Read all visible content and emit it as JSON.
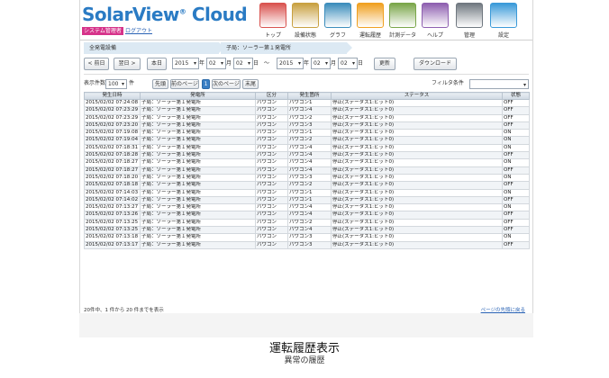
{
  "app": {
    "logo": "SolarView",
    "logo_suffix": "Cloud",
    "system_badge": "システム管理者",
    "logout": "ログアウト"
  },
  "nav": [
    {
      "label": "トップ",
      "icon": "house-icon",
      "color": "#d9534f"
    },
    {
      "label": "設備状態",
      "icon": "building-icon",
      "color": "#c8a040"
    },
    {
      "label": "グラフ",
      "icon": "bar-chart-icon",
      "color": "#3c8dbc"
    },
    {
      "label": "運転履歴",
      "icon": "log-icon",
      "color": "#f0a020"
    },
    {
      "label": "計測データ",
      "icon": "data-sheet-icon",
      "color": "#7aa64a"
    },
    {
      "label": "ヘルプ",
      "icon": "help-book-icon",
      "color": "#8e5fb0"
    },
    {
      "label": "管理",
      "icon": "gears-icon",
      "color": "#707880"
    },
    {
      "label": "設定",
      "icon": "monitor-user-icon",
      "color": "#3a9ad9"
    }
  ],
  "breadcrumb": [
    "全発電設備",
    "子局：ソーラー第１発電所"
  ],
  "datebar": {
    "prev_day": "< 前日",
    "next_day": "翌日 >",
    "today": "本日",
    "from_year": "2015",
    "year_label": "年",
    "from_month": "02",
    "month_label": "月",
    "from_day": "02",
    "day_label": "日",
    "tilde": "～",
    "to_year": "2015",
    "to_month": "02",
    "to_day": "02",
    "refresh": "更新",
    "download": "ダウンロード"
  },
  "pager": {
    "per_page_label": "表示件数",
    "per_page": "100",
    "per_page_unit": "件",
    "first": "先頭",
    "prev": "前のページ",
    "current": "1",
    "next": "次のページ",
    "last": "末尾",
    "filter_label": "フィルタ条件",
    "filter_value": ""
  },
  "table": {
    "headers": [
      "発生日時",
      "発電所",
      "区分",
      "発生箇所",
      "ステータス",
      "状態"
    ],
    "rows": [
      [
        "2015/02/02 07:24:08",
        "子局：ソーラー第１発電所",
        "パワコン",
        "パワコン1",
        "停止(ステータス1:ビット0)",
        "OFF"
      ],
      [
        "2015/02/02 07:23:29",
        "子局：ソーラー第１発電所",
        "パワコン",
        "パワコン4",
        "停止(ステータス1:ビット0)",
        "OFF"
      ],
      [
        "2015/02/02 07:23:29",
        "子局：ソーラー第１発電所",
        "パワコン",
        "パワコン2",
        "停止(ステータス1:ビット0)",
        "OFF"
      ],
      [
        "2015/02/02 07:23:20",
        "子局：ソーラー第１発電所",
        "パワコン",
        "パワコン3",
        "停止(ステータス1:ビット0)",
        "OFF"
      ],
      [
        "2015/02/02 07:19:08",
        "子局：ソーラー第１発電所",
        "パワコン",
        "パワコン1",
        "停止(ステータス1:ビット0)",
        "ON"
      ],
      [
        "2015/02/02 07:19:04",
        "子局：ソーラー第１発電所",
        "パワコン",
        "パワコン2",
        "停止(ステータス1:ビット0)",
        "ON"
      ],
      [
        "2015/02/02 07:18:31",
        "子局：ソーラー第１発電所",
        "パワコン",
        "パワコン4",
        "停止(ステータス1:ビット0)",
        "ON"
      ],
      [
        "2015/02/02 07:18:28",
        "子局：ソーラー第１発電所",
        "パワコン",
        "パワコン4",
        "停止(ステータス1:ビット0)",
        "OFF"
      ],
      [
        "2015/02/02 07:18:27",
        "子局：ソーラー第１発電所",
        "パワコン",
        "パワコン4",
        "停止(ステータス1:ビット0)",
        "ON"
      ],
      [
        "2015/02/02 07:18:27",
        "子局：ソーラー第１発電所",
        "パワコン",
        "パワコン4",
        "停止(ステータス1:ビット0)",
        "OFF"
      ],
      [
        "2015/02/02 07:18:20",
        "子局：ソーラー第１発電所",
        "パワコン",
        "パワコン3",
        "停止(ステータス1:ビット0)",
        "ON"
      ],
      [
        "2015/02/02 07:18:18",
        "子局：ソーラー第１発電所",
        "パワコン",
        "パワコン2",
        "停止(ステータス1:ビット0)",
        "OFF"
      ],
      [
        "2015/02/02 07:14:03",
        "子局：ソーラー第１発電所",
        "パワコン",
        "パワコン1",
        "停止(ステータス1:ビット0)",
        "ON"
      ],
      [
        "2015/02/02 07:14:02",
        "子局：ソーラー第１発電所",
        "パワコン",
        "パワコン1",
        "停止(ステータス1:ビット0)",
        "OFF"
      ],
      [
        "2015/02/02 07:13:27",
        "子局：ソーラー第１発電所",
        "パワコン",
        "パワコン4",
        "停止(ステータス1:ビット0)",
        "ON"
      ],
      [
        "2015/02/02 07:13:26",
        "子局：ソーラー第１発電所",
        "パワコン",
        "パワコン4",
        "停止(ステータス1:ビット0)",
        "OFF"
      ],
      [
        "2015/02/02 07:13:25",
        "子局：ソーラー第１発電所",
        "パワコン",
        "パワコン2",
        "停止(ステータス1:ビット0)",
        "OFF"
      ],
      [
        "2015/02/02 07:13:25",
        "子局：ソーラー第１発電所",
        "パワコン",
        "パワコン4",
        "停止(ステータス1:ビット0)",
        "OFF"
      ],
      [
        "2015/02/02 07:13:18",
        "子局：ソーラー第１発電所",
        "パワコン",
        "パワコン3",
        "停止(ステータス1:ビット0)",
        "ON"
      ],
      [
        "2015/02/02 07:13:17",
        "子局：ソーラー第１発電所",
        "パワコン",
        "パワコン3",
        "停止(ステータス1:ビット0)",
        "OFF"
      ]
    ]
  },
  "footer": {
    "count_text": "20件中、1 件から 20 件までを表示",
    "back_to_top": "ページの先頭に戻る"
  },
  "caption": {
    "title": "運転履歴表示",
    "subtitle": "異常の履歴"
  },
  "colors": {
    "brand": "#2a7bc4",
    "badge": "#d6338a",
    "header_cell": "#cfd9e3"
  }
}
